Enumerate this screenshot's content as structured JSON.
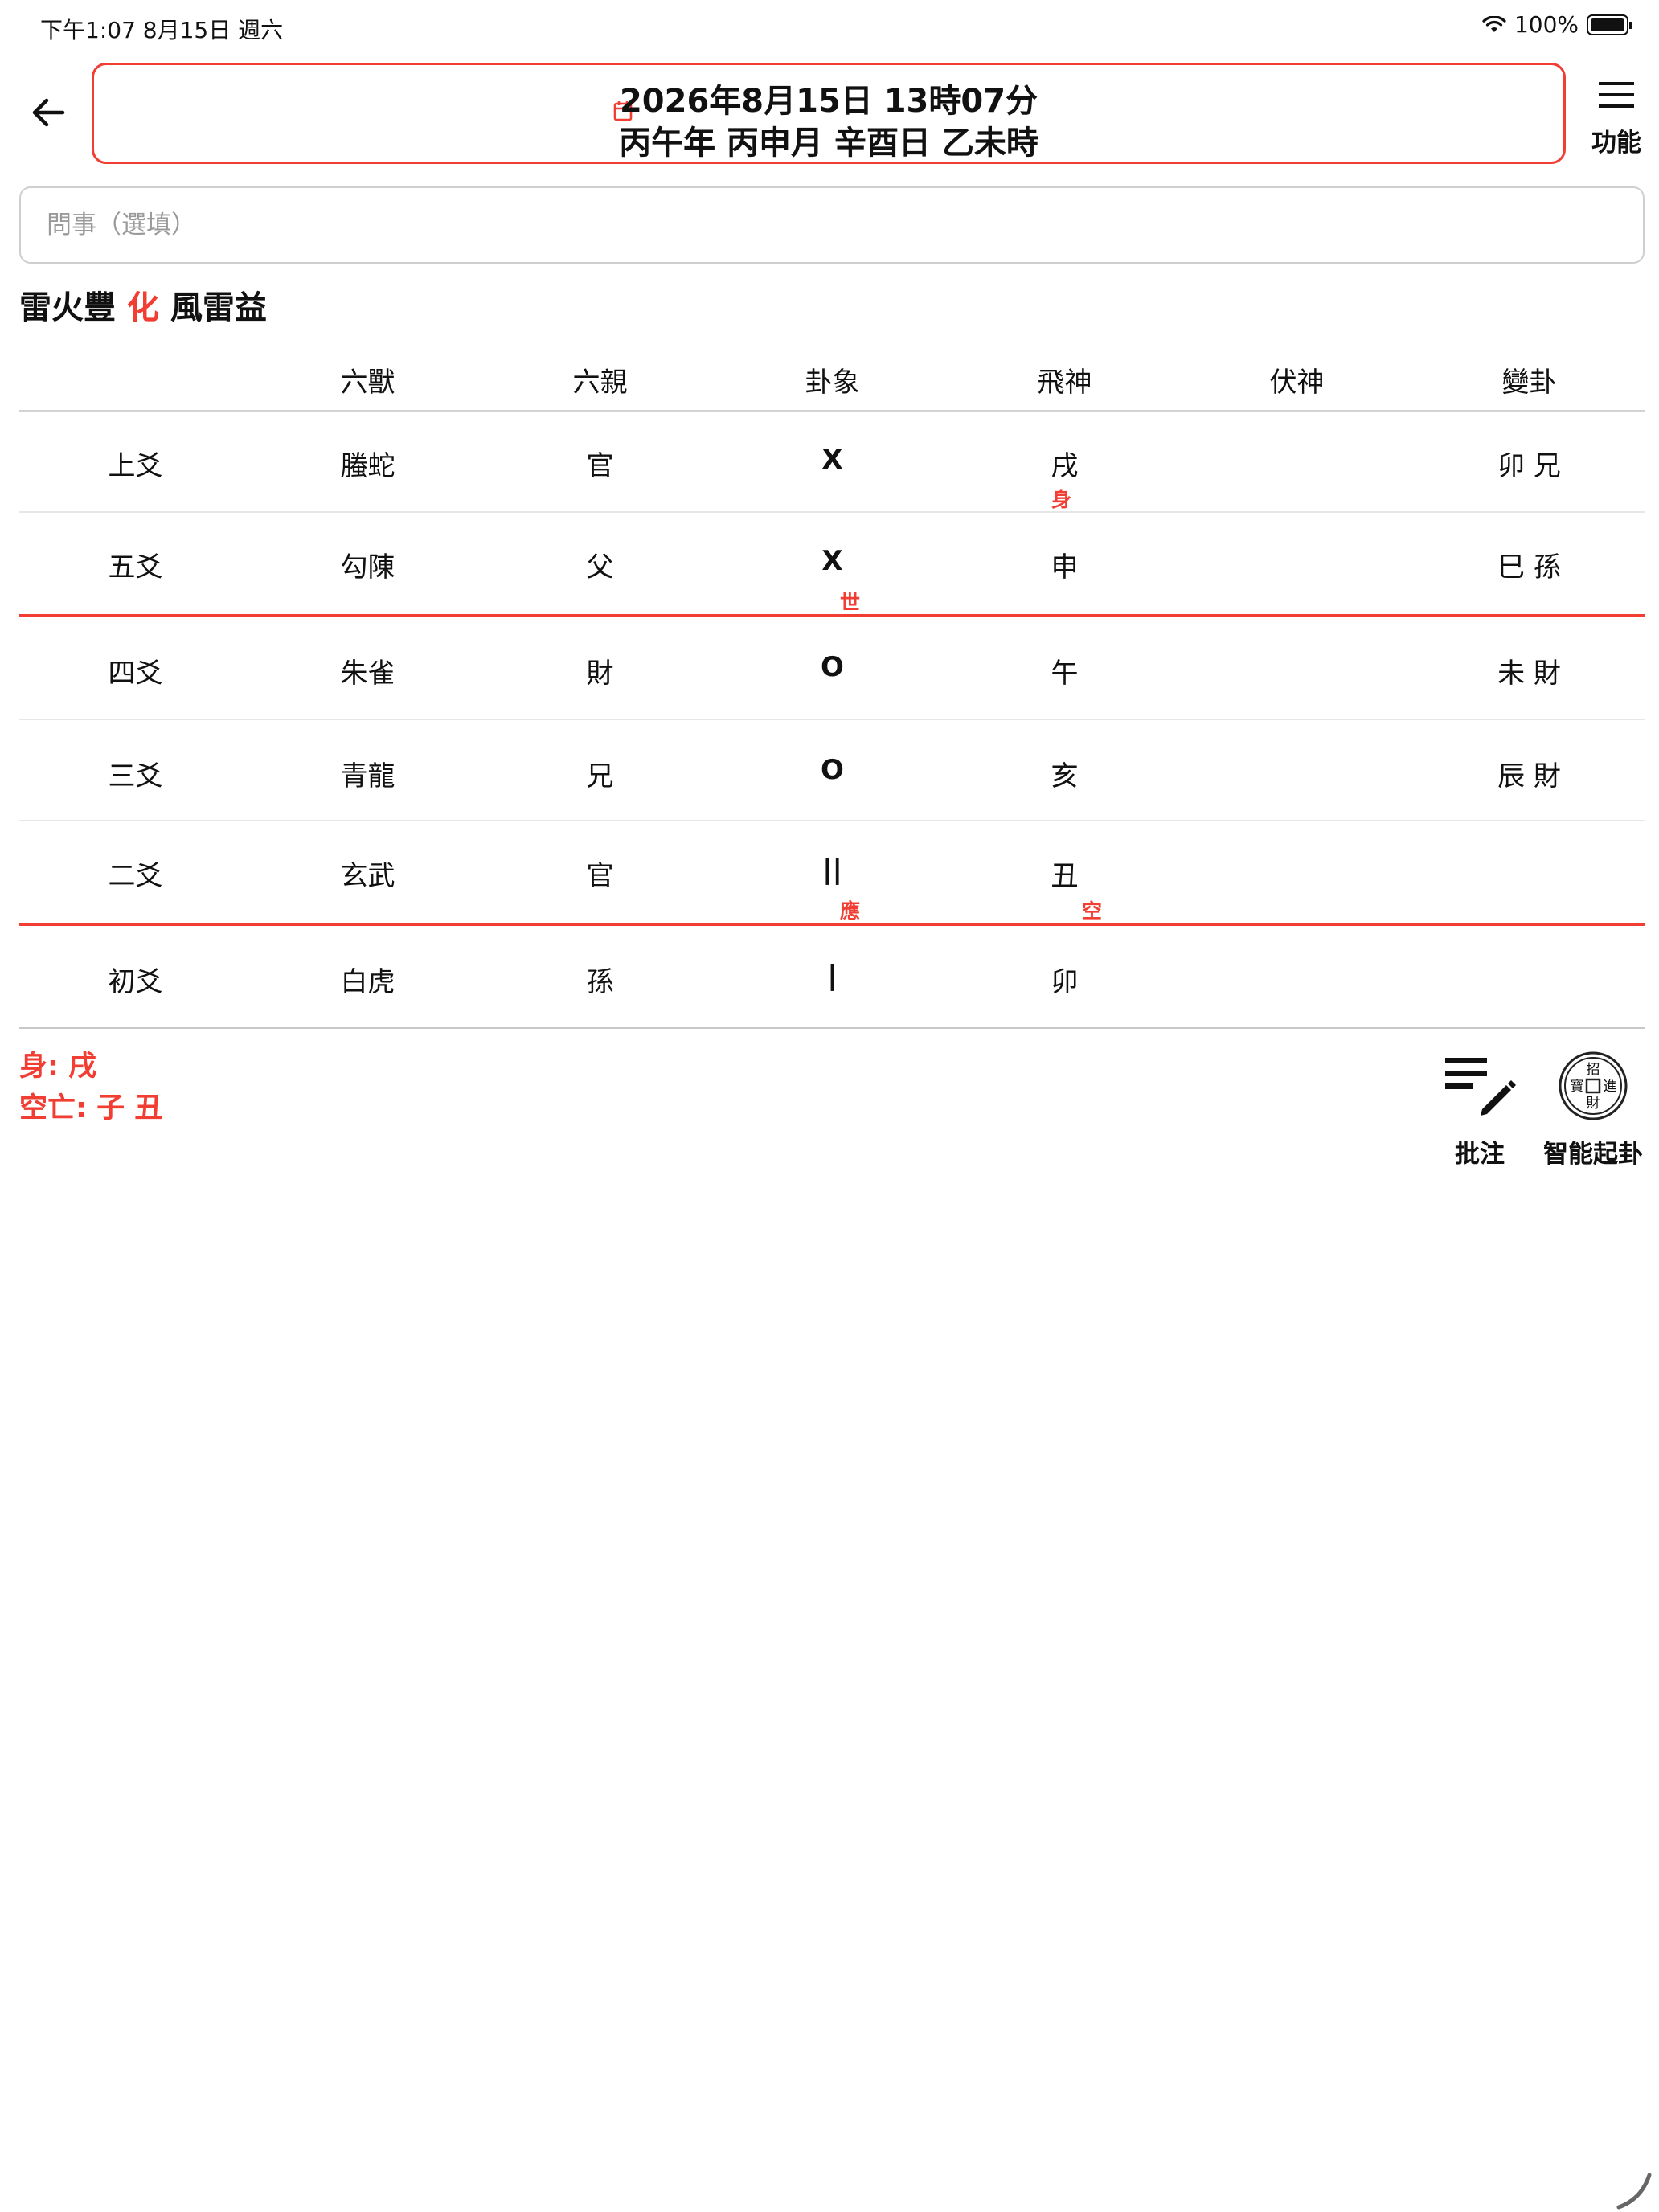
{
  "status_bar": {
    "time_date": "下午1:07   8月15日 週六",
    "battery": "100%"
  },
  "header": {
    "date": "2026年8月15日 13時07分",
    "ganzhi": "丙午年 丙申月 辛酉日 乙未時",
    "menu_label": "功能"
  },
  "question": {
    "placeholder": "問事（選填）",
    "value": ""
  },
  "hexagram": {
    "original": "雷火豐",
    "connector": "化",
    "changed": "風雷益"
  },
  "table": {
    "columns": [
      "",
      "六獸",
      "六親",
      "卦象",
      "飛神",
      "伏神",
      "變卦"
    ],
    "rows": [
      {
        "position": "上爻",
        "beast": "螣蛇",
        "relative": "官",
        "symbol": "X",
        "flying": "戌",
        "hidden": "",
        "changed": "卯 兄",
        "marker": "身"
      },
      {
        "position": "五爻",
        "beast": "勾陳",
        "relative": "父",
        "symbol": "X",
        "flying": "申",
        "hidden": "",
        "changed": "巳 孫",
        "marker": "世"
      },
      {
        "position": "四爻",
        "beast": "朱雀",
        "relative": "財",
        "symbol": "O",
        "flying": "午",
        "hidden": "",
        "changed": "未 財",
        "marker": ""
      },
      {
        "position": "三爻",
        "beast": "青龍",
        "relative": "兄",
        "symbol": "O",
        "flying": "亥",
        "hidden": "",
        "changed": "辰 財",
        "marker": ""
      },
      {
        "position": "二爻",
        "beast": "玄武",
        "relative": "官",
        "symbol": "||",
        "flying": "丑",
        "hidden": "",
        "changed": "",
        "marker": "應",
        "marker2": "空"
      },
      {
        "position": "初爻",
        "beast": "白虎",
        "relative": "孫",
        "symbol": "|",
        "flying": "卯",
        "hidden": "",
        "changed": "",
        "marker": ""
      }
    ]
  },
  "notes": {
    "body": "身: 戌",
    "void": "空亡: 子 丑"
  },
  "actions": {
    "annotate_label": "批注",
    "smart_label": "智能起卦",
    "coin_chars": [
      "招",
      "寶",
      "進",
      "財"
    ]
  },
  "colors": {
    "accent": "#f23d33",
    "text": "#111111",
    "divider": "#e6e6e6"
  }
}
